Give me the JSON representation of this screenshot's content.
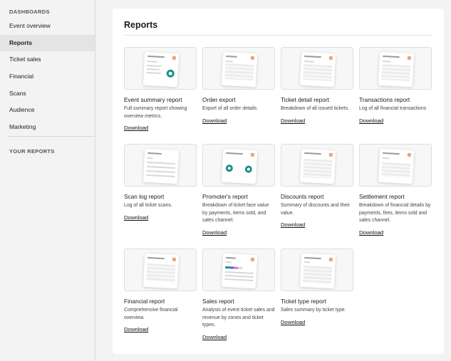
{
  "sidebar": {
    "heading": "DASHBOARDS",
    "items": [
      {
        "label": "Event overview"
      },
      {
        "label": "Reports"
      },
      {
        "label": "Ticket sales"
      },
      {
        "label": "Financial"
      },
      {
        "label": "Scans"
      },
      {
        "label": "Audience"
      },
      {
        "label": "Marketing"
      }
    ],
    "active_index": 1,
    "heading2": "YOUR REPORTS"
  },
  "main": {
    "title": "Reports",
    "reports": [
      {
        "title": "Event summary report",
        "desc": "Full summary report showing overview metrics.",
        "link": "Download"
      },
      {
        "title": "Order export",
        "desc": "Export of all order details.",
        "link": "Download"
      },
      {
        "title": "Ticket detail report",
        "desc": "Breakdown of all issued tickets.",
        "link": "Download"
      },
      {
        "title": "Transactions report",
        "desc": "Log of all financial transactions",
        "link": "Download"
      },
      {
        "title": "Scan log report",
        "desc": "Log of all ticket scans.",
        "link": "Download"
      },
      {
        "title": "Promoter's report",
        "desc": "Breakdown of ticket face value by payments, items sold, and sales channel.",
        "link": "Download"
      },
      {
        "title": "Discounts report",
        "desc": "Summary of discounts and their value.",
        "link": "Download"
      },
      {
        "title": "Settlement report",
        "desc": "Breakdown of financial details by payments, fees, items sold and sales channel.",
        "link": "Download"
      },
      {
        "title": "Financial report",
        "desc": "Comprehensive financial overview.",
        "link": "Download"
      },
      {
        "title": "Sales report",
        "desc": "Analysis of event ticket sales and revenue by zones and ticket types.",
        "link": "Download"
      },
      {
        "title": "Ticket type report",
        "desc": "Sales summary by ticket type.",
        "link": "Download"
      }
    ]
  },
  "colors": {
    "accent_teal": "#1b8f8a",
    "badge_orange": "#f0a27a"
  }
}
